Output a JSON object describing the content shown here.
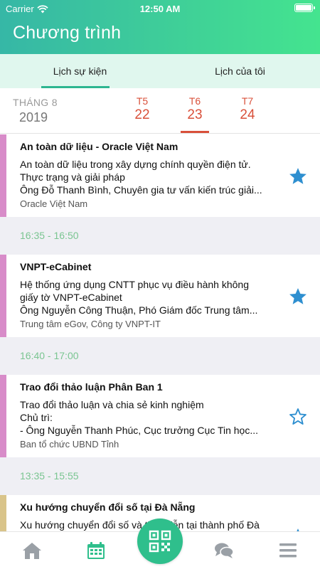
{
  "status": {
    "carrier": "Carrier",
    "time": "12:50 AM"
  },
  "header": {
    "title": "Chương trình"
  },
  "tabs": [
    {
      "label": "Lịch sự kiện",
      "active": true
    },
    {
      "label": "Lịch của tôi",
      "active": false
    }
  ],
  "date_selector": {
    "month": "THÁNG 8",
    "year": "2019",
    "days": [
      {
        "weekday": "T5",
        "day": "22",
        "selected": false
      },
      {
        "weekday": "T6",
        "day": "23",
        "selected": true
      },
      {
        "weekday": "T7",
        "day": "24",
        "selected": false
      }
    ]
  },
  "events": [
    {
      "title": "An toàn dữ liệu - Oracle Việt Nam",
      "desc_lines": [
        "An toàn dữ liệu trong xây dựng chính quyền điện tử.",
        "Thực trạng và giải pháp",
        "Ông Đỗ Thanh Bình, Chuyên gia tư vấn kiến trúc giải..."
      ],
      "org": "Oracle Việt Nam",
      "starred": true,
      "color": "#d88cc9"
    },
    {
      "time_before": "16:35 - 16:50",
      "title": "VNPT-eCabinet",
      "desc_lines": [
        "Hệ thống ứng dụng CNTT phục vụ điều hành không",
        "giấy tờ VNPT-eCabinet",
        "Ông Nguyễn Công Thuận, Phó Giám đốc Trung tâm..."
      ],
      "org": "Trung tâm eGov, Công ty VNPT-IT",
      "starred": true,
      "color": "#d88cc9"
    },
    {
      "time_before": "16:40 - 17:00",
      "title": "Trao đổi thảo luận Phân Ban 1",
      "desc_lines": [
        "Trao đổi thảo luận và chia sẻ kinh nghiệm",
        "Chủ trì:",
        "-  Ông Nguyễn Thanh Phúc, Cục trưởng Cục Tin học..."
      ],
      "org": "Ban tổ chức UBND Tỉnh",
      "starred": false,
      "color": "#d88cc9"
    },
    {
      "time_before": "13:35 - 15:55",
      "title": "Xu hướng chuyển đổi số tại Đà Nẵng",
      "desc_lines": [
        "Xu hướng chuyển đổi số và thực tiễn tại thành phố Đà"
      ],
      "org": "",
      "starred": true,
      "color": "#d9c48a"
    }
  ],
  "colors": {
    "accent": "#2fbf8c",
    "date_red": "#d9503a",
    "star_blue": "#2e8fd0",
    "time_green": "#7ac591"
  },
  "bottom_nav": [
    {
      "icon": "home-icon"
    },
    {
      "icon": "calendar-icon",
      "active": true
    },
    {
      "icon": "qr-code-icon"
    },
    {
      "icon": "chat-icon"
    },
    {
      "icon": "menu-icon"
    }
  ]
}
